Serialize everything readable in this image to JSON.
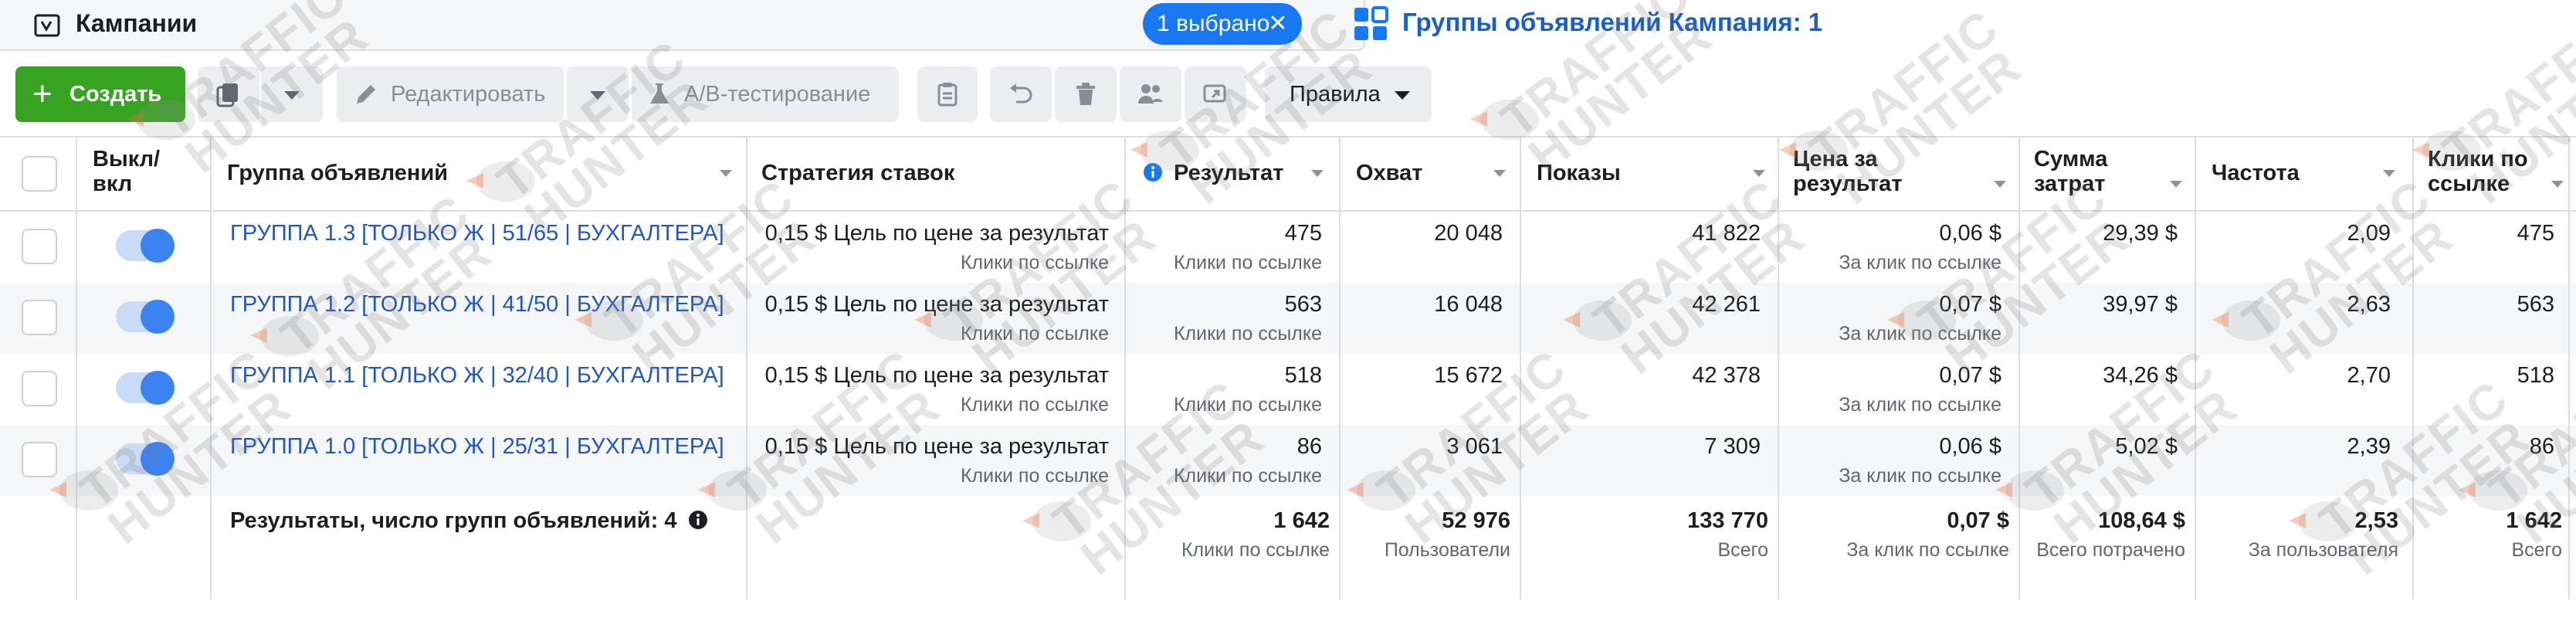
{
  "header": {
    "campaigns_title": "Кампании",
    "selection_pill": "1 выбрано",
    "adsets_title": "Группы объявлений Кампания: 1"
  },
  "toolbar": {
    "create_label": "Создать",
    "edit_label": "Редактировать",
    "ab_label": "A/B-тестирование",
    "rules_label": "Правила"
  },
  "table": {
    "columns": {
      "toggle": "Выкл/ вкл",
      "ad_group": "Группа объявлений",
      "bid_strategy": "Стратегия ставок",
      "result": "Результат",
      "reach": "Охват",
      "impressions": "Показы",
      "cost_per_result": "Цена за результат",
      "spent": "Сумма затрат",
      "frequency": "Частота",
      "link_clicks": "Клики по ссылке"
    },
    "rows": [
      {
        "name": "ГРУППА 1.3 [ТОЛЬКО Ж | 51/65 | БУХГАЛТЕРА]",
        "bid": "0,15 $ Цель по цене за результат",
        "bid_sub": "Клики по ссылке",
        "result": "475",
        "result_sub": "Клики по ссылке",
        "reach": "20 048",
        "impressions": "41 822",
        "cpr": "0,06 $",
        "cpr_sub": "За клик по ссылке",
        "spent": "29,39 $",
        "frequency": "2,09",
        "clicks": "475"
      },
      {
        "name": "ГРУППА 1.2 [ТОЛЬКО Ж | 41/50 | БУХГАЛТЕРА]",
        "bid": "0,15 $ Цель по цене за результат",
        "bid_sub": "Клики по ссылке",
        "result": "563",
        "result_sub": "Клики по ссылке",
        "reach": "16 048",
        "impressions": "42 261",
        "cpr": "0,07 $",
        "cpr_sub": "За клик по ссылке",
        "spent": "39,97 $",
        "frequency": "2,63",
        "clicks": "563"
      },
      {
        "name": "ГРУППА 1.1 [ТОЛЬКО Ж | 32/40 | БУХГАЛТЕРА]",
        "bid": "0,15 $ Цель по цене за результат",
        "bid_sub": "Клики по ссылке",
        "result": "518",
        "result_sub": "Клики по ссылке",
        "reach": "15 672",
        "impressions": "42 378",
        "cpr": "0,07 $",
        "cpr_sub": "За клик по ссылке",
        "spent": "34,26 $",
        "frequency": "2,70",
        "clicks": "518"
      },
      {
        "name": "ГРУППА 1.0 [ТОЛЬКО Ж | 25/31 | БУХГАЛТЕРА]",
        "bid": "0,15 $ Цель по цене за результат",
        "bid_sub": "Клики по ссылке",
        "result": "86",
        "result_sub": "Клики по ссылке",
        "reach": "3 061",
        "impressions": "7 309",
        "cpr": "0,06 $",
        "cpr_sub": "За клик по ссылке",
        "spent": "5,02 $",
        "frequency": "2,39",
        "clicks": "86"
      }
    ],
    "summary": {
      "label": "Результаты, число групп объявлений: 4",
      "result": "1 642",
      "result_sub": "Клики по ссылке",
      "reach": "52 976",
      "reach_sub": "Пользователи",
      "impressions": "133 770",
      "impressions_sub": "Всего",
      "cpr": "0,07 $",
      "cpr_sub": "За клик по ссылке",
      "spent": "108,64 $",
      "spent_sub": "Всего потрачено",
      "frequency": "2,53",
      "frequency_sub": "За пользователя",
      "clicks": "1 642",
      "clicks_sub": "Всего"
    }
  },
  "watermark": {
    "line1": "TRAFFIC",
    "line2": "HUNTER"
  },
  "colors": {
    "primary_blue": "#1877f2",
    "link_blue": "#2256c3",
    "create_green": "#36a420"
  }
}
